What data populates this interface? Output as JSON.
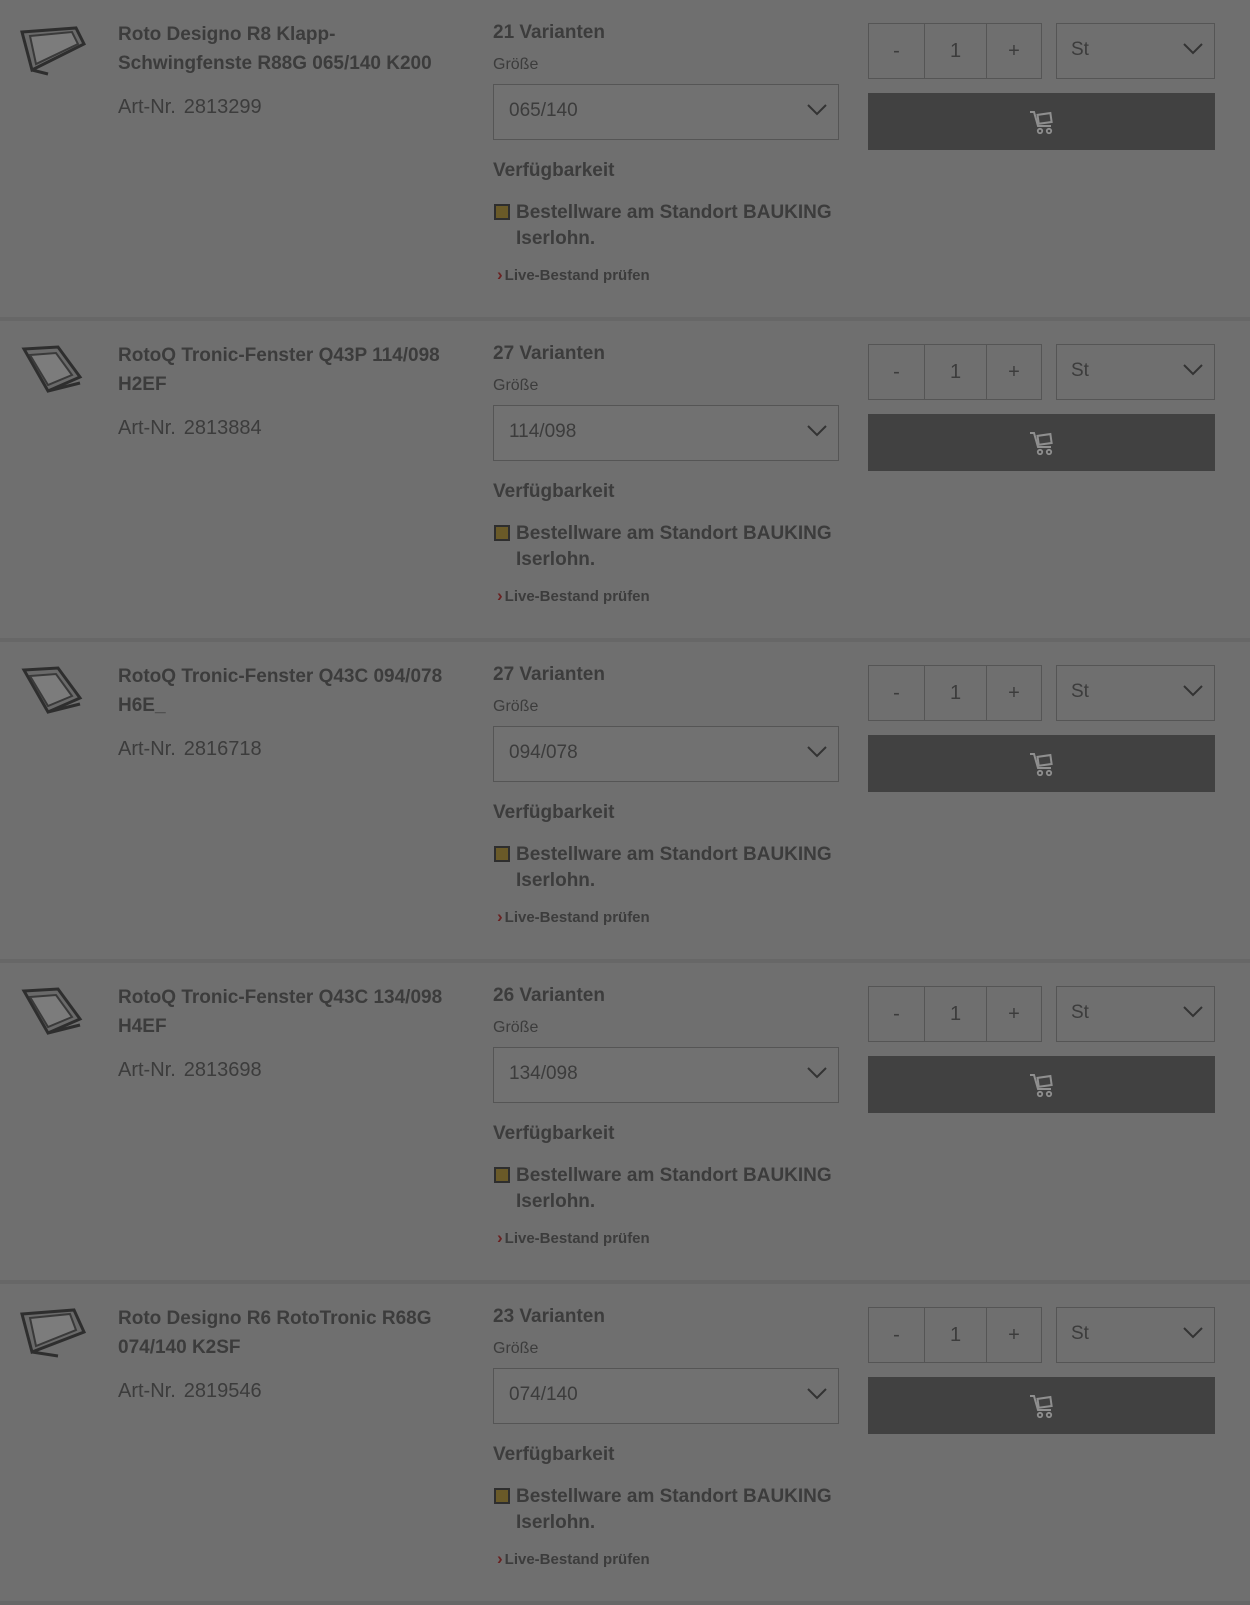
{
  "products": [
    {
      "title": "Roto Designo R8 Klapp-Schwingfenste R88G 065/140 K200",
      "art_label": "Art-Nr.",
      "art_nr": "2813299",
      "variants": "21 Varianten",
      "size_label": "Größe",
      "size_value": "065/140",
      "availability_label": "Verfügbarkeit",
      "availability_text": "Bestellware am Standort BAUKING Iserlohn.",
      "live_link": "Live-Bestand prüfen",
      "qty_minus": "-",
      "qty_value": "1",
      "qty_plus": "+",
      "unit": "St"
    },
    {
      "title": "RotoQ Tronic-Fenster Q43P 114/098 H2EF",
      "art_label": "Art-Nr.",
      "art_nr": "2813884",
      "variants": "27 Varianten",
      "size_label": "Größe",
      "size_value": "114/098",
      "availability_label": "Verfügbarkeit",
      "availability_text": "Bestellware am Standort BAUKING Iserlohn.",
      "live_link": "Live-Bestand prüfen",
      "qty_minus": "-",
      "qty_value": "1",
      "qty_plus": "+",
      "unit": "St"
    },
    {
      "title": "RotoQ Tronic-Fenster Q43C 094/078 H6E_",
      "art_label": "Art-Nr.",
      "art_nr": "2816718",
      "variants": "27 Varianten",
      "size_label": "Größe",
      "size_value": "094/078",
      "availability_label": "Verfügbarkeit",
      "availability_text": "Bestellware am Standort BAUKING Iserlohn.",
      "live_link": "Live-Bestand prüfen",
      "qty_minus": "-",
      "qty_value": "1",
      "qty_plus": "+",
      "unit": "St"
    },
    {
      "title": "RotoQ Tronic-Fenster Q43C 134/098 H4EF",
      "art_label": "Art-Nr.",
      "art_nr": "2813698",
      "variants": "26 Varianten",
      "size_label": "Größe",
      "size_value": "134/098",
      "availability_label": "Verfügbarkeit",
      "availability_text": "Bestellware am Standort BAUKING Iserlohn.",
      "live_link": "Live-Bestand prüfen",
      "qty_minus": "-",
      "qty_value": "1",
      "qty_plus": "+",
      "unit": "St"
    },
    {
      "title": "Roto Designo R6 RotoTronic R68G 074/140 K2SF",
      "art_label": "Art-Nr.",
      "art_nr": "2819546",
      "variants": "23 Varianten",
      "size_label": "Größe",
      "size_value": "074/140",
      "availability_label": "Verfügbarkeit",
      "availability_text": "Bestellware am Standort BAUKING Iserlohn.",
      "live_link": "Live-Bestand prüfen",
      "qty_minus": "-",
      "qty_value": "1",
      "qty_plus": "+",
      "unit": "St"
    }
  ],
  "icons": {
    "thumbnail": "roof-window-icon",
    "dropdown": "chevron-down-icon",
    "cart": "shopping-cart-icon",
    "availability": "availability-status-icon",
    "link_chevron": "chevron-right-icon"
  },
  "colors": {
    "overlay_background": "#6f6f6f",
    "cart_button": "#414141",
    "availability_indicator": "#6a5a28",
    "link_chevron": "#6a2222"
  }
}
